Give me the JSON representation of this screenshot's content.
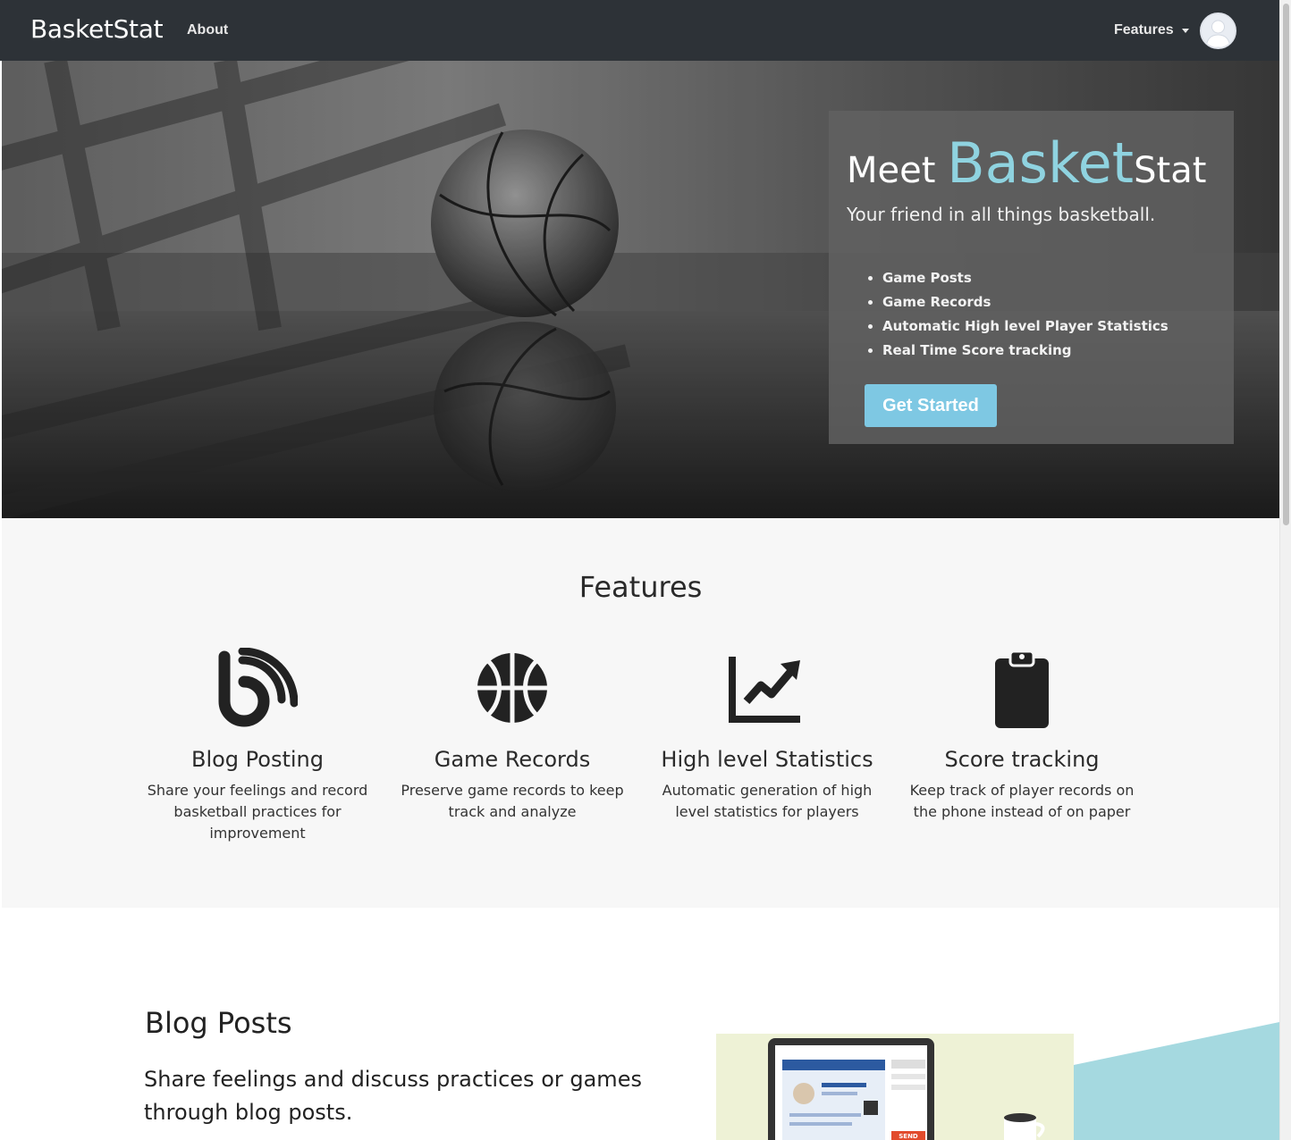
{
  "navbar": {
    "brand": "BasketStat",
    "about": "About",
    "features": "Features"
  },
  "hero": {
    "title_meet": "Meet ",
    "title_basket": "Basket",
    "title_stat": "Stat",
    "subtitle": "Your friend in all things basketball.",
    "list": [
      "Game Posts",
      "Game Records",
      "Automatic High level Player Statistics",
      "Real Time Score tracking"
    ],
    "button": "Get Started"
  },
  "features": {
    "title": "Features",
    "items": [
      {
        "icon": "blog-rss-icon",
        "title": "Blog Posting",
        "desc": "Share your feelings and record basketball practices for improvement"
      },
      {
        "icon": "basketball-icon",
        "title": "Game Records",
        "desc": "Preserve game records to keep track and analyze"
      },
      {
        "icon": "chart-line-icon",
        "title": "High level Statistics",
        "desc": "Automatic generation of high level statistics for players"
      },
      {
        "icon": "clipboard-icon",
        "title": "Score tracking",
        "desc": "Keep track of player records on the phone instead of on paper"
      }
    ]
  },
  "blog": {
    "title": "Blog Posts",
    "desc": "Share feelings and discuss practices or games through blog posts.",
    "send_label": "SEND"
  },
  "colors": {
    "navbar": "#2d3237",
    "accent": "#8fd3e0",
    "button": "#7ec8e3",
    "features_bg": "#f7f7f7"
  }
}
